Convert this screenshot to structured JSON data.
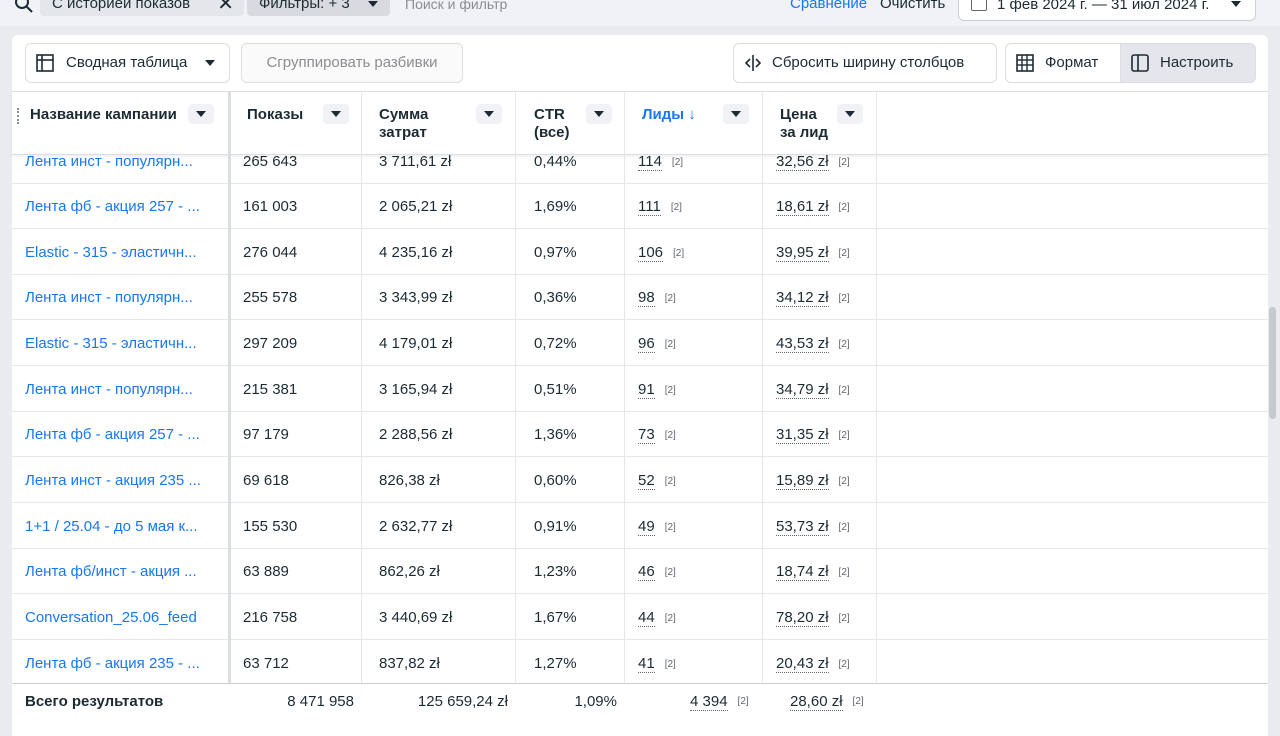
{
  "topbar": {
    "chip_history": "С историей показов",
    "chip_filters": "Фильтры: + 3",
    "search_placeholder": "Поиск и фильтр",
    "compare": "Сравнение",
    "clear": "Очистить",
    "date_range": "1 фев 2024 г. — 31 июл 2024 г."
  },
  "toolbar": {
    "pivot": "Сводная таблица",
    "group": "Сгруппировать разбивки",
    "reset_width": "Сбросить ширину столбцов",
    "format": "Формат",
    "customize": "Настроить"
  },
  "columns": {
    "name": "Название кампании",
    "impressions": "Показы",
    "cost_1": "Сумма",
    "cost_2": "затрат",
    "ctr_1": "CTR",
    "ctr_2": "(все)",
    "leads": "Лиды ↓",
    "cpl_1": "Цена",
    "cpl_2": "за лид"
  },
  "rows": [
    {
      "name": "Лента инст - популярн...",
      "impressions": "265 643",
      "cost": "3 711,61 zł",
      "ctr": "0,44%",
      "leads": "114",
      "leads_badge": "[2]",
      "cpl": "32,56 zł",
      "cpl_badge": "[2]"
    },
    {
      "name": "Лента фб - акция 257 - ...",
      "impressions": "161 003",
      "cost": "2 065,21 zł",
      "ctr": "1,69%",
      "leads": "111",
      "leads_badge": "[2]",
      "cpl": "18,61 zł",
      "cpl_badge": "[2]"
    },
    {
      "name": "Elastic - 315 - эластичн...",
      "impressions": "276 044",
      "cost": "4 235,16 zł",
      "ctr": "0,97%",
      "leads": "106",
      "leads_badge": "[2]",
      "cpl": "39,95 zł",
      "cpl_badge": "[2]"
    },
    {
      "name": "Лента инст - популярн...",
      "impressions": "255 578",
      "cost": "3 343,99 zł",
      "ctr": "0,36%",
      "leads": "98",
      "leads_badge": "[2]",
      "cpl": "34,12 zł",
      "cpl_badge": "[2]"
    },
    {
      "name": "Elastic - 315 - эластичн...",
      "impressions": "297 209",
      "cost": "4 179,01 zł",
      "ctr": "0,72%",
      "leads": "96",
      "leads_badge": "[2]",
      "cpl": "43,53 zł",
      "cpl_badge": "[2]"
    },
    {
      "name": "Лента инст - популярн...",
      "impressions": "215 381",
      "cost": "3 165,94 zł",
      "ctr": "0,51%",
      "leads": "91",
      "leads_badge": "[2]",
      "cpl": "34,79 zł",
      "cpl_badge": "[2]"
    },
    {
      "name": "Лента фб - акция 257 - ...",
      "impressions": "97 179",
      "cost": "2 288,56 zł",
      "ctr": "1,36%",
      "leads": "73",
      "leads_badge": "[2]",
      "cpl": "31,35 zł",
      "cpl_badge": "[2]"
    },
    {
      "name": "Лента инст - акция 235 ...",
      "impressions": "69 618",
      "cost": "826,38 zł",
      "ctr": "0,60%",
      "leads": "52",
      "leads_badge": "[2]",
      "cpl": "15,89 zł",
      "cpl_badge": "[2]"
    },
    {
      "name": "1+1 / 25.04 - до 5 мая к...",
      "impressions": "155 530",
      "cost": "2 632,77 zł",
      "ctr": "0,91%",
      "leads": "49",
      "leads_badge": "[2]",
      "cpl": "53,73 zł",
      "cpl_badge": "[2]"
    },
    {
      "name": "Лента фб/инст - акция ...",
      "impressions": "63 889",
      "cost": "862,26 zł",
      "ctr": "1,23%",
      "leads": "46",
      "leads_badge": "[2]",
      "cpl": "18,74 zł",
      "cpl_badge": "[2]"
    },
    {
      "name": "Conversation_25.06_feed",
      "impressions": "216 758",
      "cost": "3 440,69 zł",
      "ctr": "1,67%",
      "leads": "44",
      "leads_badge": "[2]",
      "cpl": "78,20 zł",
      "cpl_badge": "[2]"
    },
    {
      "name": "Лента фб - акция 235 - ...",
      "impressions": "63 712",
      "cost": "837,82 zł",
      "ctr": "1,27%",
      "leads": "41",
      "leads_badge": "[2]",
      "cpl": "20,43 zł",
      "cpl_badge": "[2]"
    }
  ],
  "totals": {
    "label": "Всего результатов",
    "impressions": "8 471 958",
    "cost": "125 659,24 zł",
    "ctr": "1,09%",
    "leads": "4 394",
    "leads_badge": "[2]",
    "cpl": "28,60 zł",
    "cpl_badge": "[2]"
  },
  "colors": {
    "accent": "#1877f2",
    "text": "#1c2b33",
    "border": "#dadde1"
  }
}
